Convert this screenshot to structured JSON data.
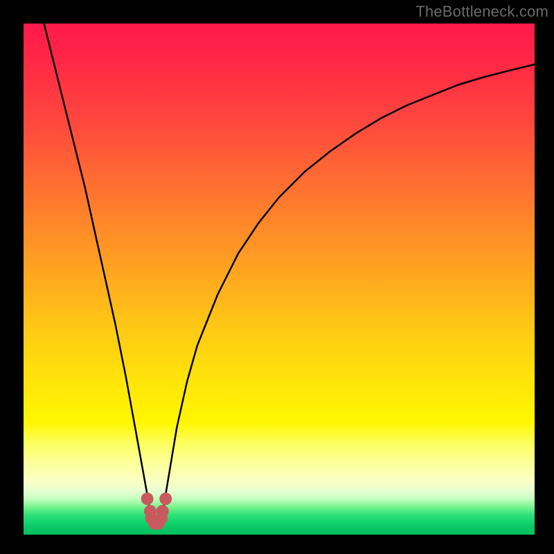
{
  "watermark": {
    "text": "TheBottleneck.com"
  },
  "colors": {
    "background": "#000000",
    "watermark_text": "#6a6a6a",
    "curve_stroke": "#000000",
    "marker_fill": "#c85a5f",
    "marker_stroke": "#c85a5f",
    "gradient_top": "#ff1a4d",
    "gradient_mid": "#fff600",
    "gradient_bottom": "#07c060"
  },
  "chart_data": {
    "type": "line",
    "title": "",
    "xlabel": "",
    "ylabel": "",
    "xlim": [
      0,
      100
    ],
    "ylim": [
      0,
      100
    ],
    "grid": false,
    "legend": false,
    "series": [
      {
        "name": "bottleneck_curve",
        "x": [
          4,
          6,
          8,
          10,
          12,
          14,
          16,
          18,
          20,
          22,
          24,
          25,
          26,
          27,
          28,
          30,
          32,
          34,
          38,
          42,
          46,
          50,
          55,
          60,
          65,
          70,
          75,
          80,
          85,
          90,
          95,
          100
        ],
        "y": [
          100,
          92,
          84,
          76,
          68,
          59,
          50,
          41,
          31,
          20,
          9,
          3,
          2,
          3,
          9,
          21,
          30,
          37,
          47,
          55,
          61,
          66,
          71,
          75,
          78.5,
          81.5,
          84,
          86,
          88,
          89.5,
          90.8,
          92
        ]
      }
    ],
    "markers": {
      "name": "highlight_dip",
      "shape": "u-cluster",
      "x": [
        24.2,
        25.0,
        25.6,
        26.4,
        27.0,
        27.8,
        24.8,
        27.2
      ],
      "y": [
        7.0,
        3.2,
        2.2,
        2.2,
        3.2,
        7.0,
        4.6,
        4.6
      ]
    },
    "annotations": []
  }
}
